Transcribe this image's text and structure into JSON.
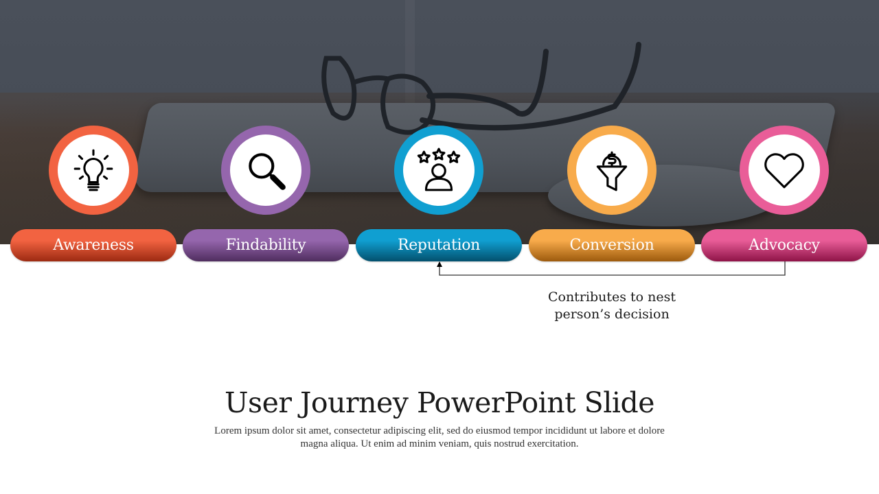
{
  "slide": {
    "title": "User Journey PowerPoint Slide",
    "description": "Lorem ipsum dolor sit amet, consectetur adipiscing elit, sed do eiusmod tempor incididunt ut labore et dolore magna aliqua. Ut enim ad minim veniam, quis nostrud exercitation.",
    "note": "Contributes to nest person’s decision",
    "background_image": "desk-with-glasses-laptop-mouse"
  },
  "steps": [
    {
      "label": "Awareness",
      "icon": "lightbulb-icon",
      "color": "#f26341",
      "pill_top": "#f26341",
      "pill_bottom": "#9c2a12"
    },
    {
      "label": "Findability",
      "icon": "magnifier-icon",
      "color": "#9566ad",
      "pill_top": "#9566ad",
      "pill_bottom": "#4f2d5e"
    },
    {
      "label": "Reputation",
      "icon": "user-rating-stars-icon",
      "color": "#109fd1",
      "pill_top": "#109fd1",
      "pill_bottom": "#03506d"
    },
    {
      "label": "Conversion",
      "icon": "dollar-funnel-icon",
      "color": "#f8ab4b",
      "pill_top": "#f8ab4b",
      "pill_bottom": "#9c5a0d"
    },
    {
      "label": "Advocacy",
      "icon": "heart-icon",
      "color": "#e95d98",
      "pill_top": "#e95d98",
      "pill_bottom": "#8e1347"
    }
  ]
}
